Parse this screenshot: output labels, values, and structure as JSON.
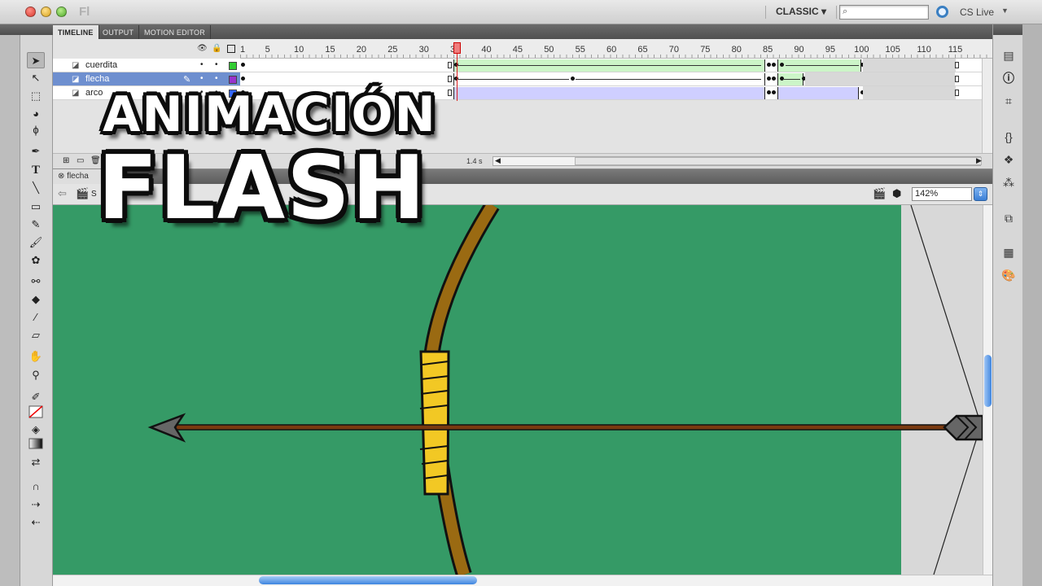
{
  "app": {
    "logo": "Fl",
    "workspace": "CLASSIC",
    "search_placeholder": "",
    "cs_live": "CS Live"
  },
  "timeline": {
    "tabs": [
      {
        "label": "TIMELINE"
      },
      {
        "label": "OUTPUT"
      },
      {
        "label": "MOTION EDITOR"
      }
    ],
    "ruler_ticks": [
      "1",
      "5",
      "10",
      "15",
      "20",
      "25",
      "30",
      "35",
      "40",
      "45",
      "50",
      "55",
      "60",
      "65",
      "70",
      "75",
      "80",
      "85",
      "90",
      "95",
      "100",
      "105",
      "110",
      "115"
    ],
    "current_frame": "35",
    "layers": [
      {
        "name": "cuerdita",
        "color": "#33cc33"
      },
      {
        "name": "flecha",
        "color": "#9933cc"
      },
      {
        "name": "arco",
        "color": "#3366ff"
      }
    ],
    "elapsed": "1.4 s"
  },
  "document": {
    "tab": "flecha",
    "scene": "S",
    "zoom": "142%"
  },
  "overlay": {
    "line1": "ANIMACIÓN",
    "line2": "FLASH"
  },
  "colors": {
    "stage": "#359a66",
    "bow": "#9a6a12",
    "grip": "#f2c824",
    "arrow_shaft": "#7a3a10",
    "arrow_head": "#666666"
  }
}
